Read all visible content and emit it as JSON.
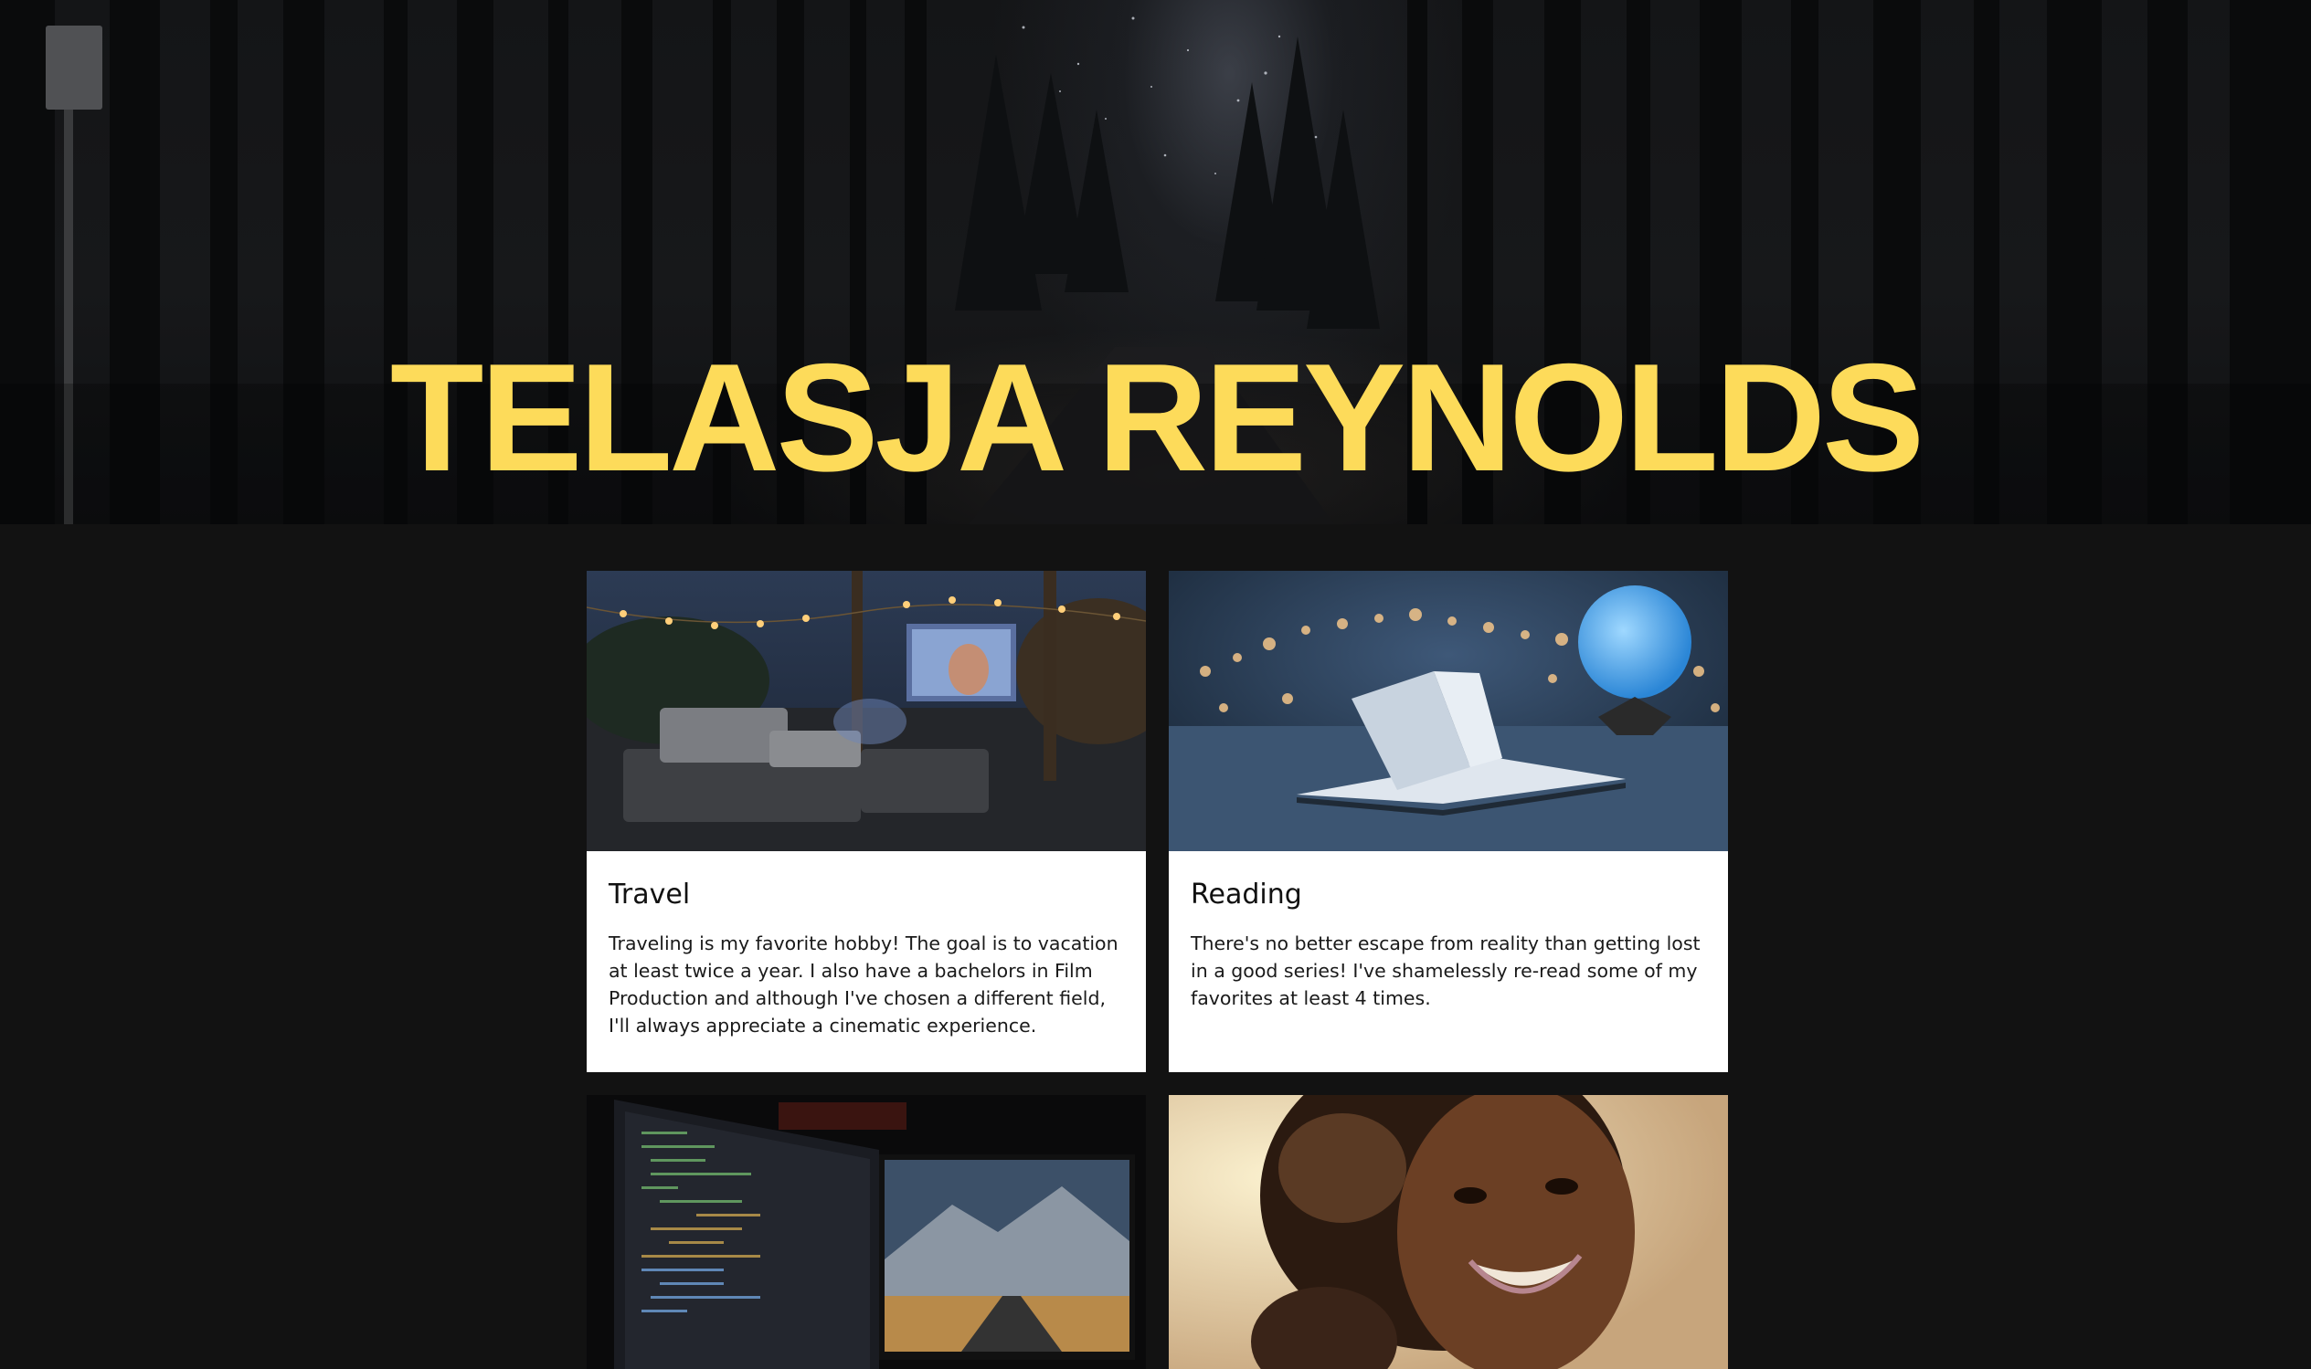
{
  "hero": {
    "title": "TELASJA REYNOLDS"
  },
  "cards": [
    {
      "title": "Travel",
      "text": "Traveling is my favorite hobby! The goal is to vacation at least twice a year. I also have a bachelors in Film Production and although I've chosen a different field, I'll always appreciate a cinematic experience.",
      "image": "backyard-movie-night-photo"
    },
    {
      "title": "Reading",
      "text": "There's no better escape from reality than getting lost in a good series! I've shamelessly re-read some of my favorites at least 4 times.",
      "image": "open-book-moon-lamp-photo"
    },
    {
      "title": "",
      "text": "",
      "image": "dual-monitor-code-photo"
    },
    {
      "title": "",
      "text": "",
      "image": "selfie-portrait-photo"
    }
  ],
  "colors": {
    "background": "#121212",
    "title": "#fddb5a",
    "card": "#ffffff"
  }
}
